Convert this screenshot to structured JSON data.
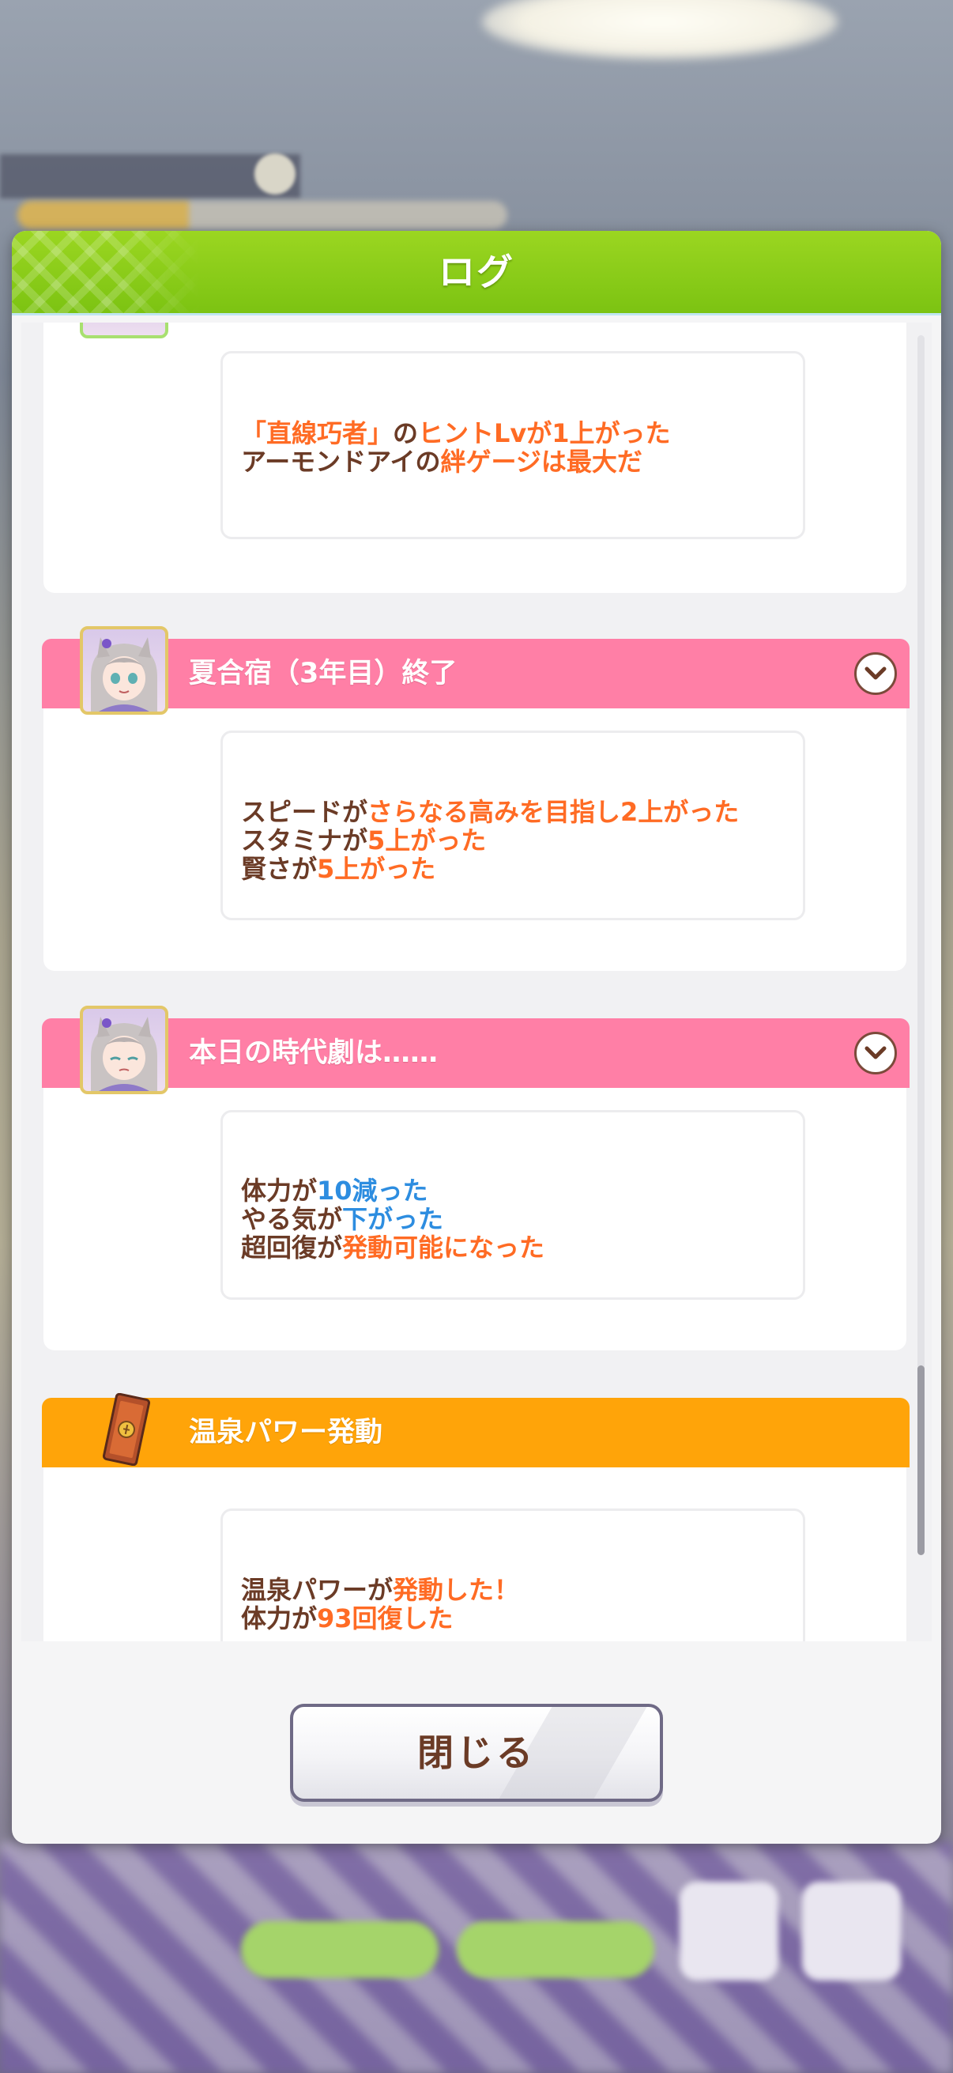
{
  "dialog": {
    "title": "ログ",
    "close_label": "閉じる"
  },
  "entries": [
    {
      "title": "",
      "lines": [
        [
          {
            "t": "「直線巧者」",
            "c": "o"
          },
          {
            "t": "の",
            "c": ""
          },
          {
            "t": "ヒントLvが1上がった",
            "c": "o"
          }
        ],
        [
          {
            "t": "アーモンドアイの",
            "c": ""
          },
          {
            "t": "絆ゲージは最大だ",
            "c": "o"
          }
        ]
      ]
    },
    {
      "title": "夏合宿（3年目）終了",
      "header_color": "pink",
      "lines": [
        [
          {
            "t": "スピードが",
            "c": ""
          },
          {
            "t": "さらなる高みを目指し2上がった",
            "c": "o"
          }
        ],
        [
          {
            "t": "スタミナが",
            "c": ""
          },
          {
            "t": "5上がった",
            "c": "o"
          }
        ],
        [
          {
            "t": "賢さが",
            "c": ""
          },
          {
            "t": "5上がった",
            "c": "o"
          }
        ]
      ]
    },
    {
      "title": "本日の時代劇は……",
      "header_color": "pink",
      "lines": [
        [
          {
            "t": "体力が",
            "c": ""
          },
          {
            "t": "10減った",
            "c": "b"
          }
        ],
        [
          {
            "t": "やる気が",
            "c": ""
          },
          {
            "t": "下がった",
            "c": "b"
          }
        ],
        [
          {
            "t": "超回復が",
            "c": ""
          },
          {
            "t": "発動可能になった",
            "c": "o"
          }
        ]
      ]
    },
    {
      "title": "温泉パワー発動",
      "header_color": "orange",
      "lines": [
        [
          {
            "t": "温泉パワーが",
            "c": ""
          },
          {
            "t": "発動した！",
            "c": "o"
          }
        ],
        [
          {
            "t": "体力が",
            "c": ""
          },
          {
            "t": "93回復した",
            "c": "o"
          }
        ]
      ]
    }
  ],
  "icons": {
    "expand": "chevron-down-icon",
    "character": "character-portrait",
    "ticket": "onsen-ticket-icon"
  },
  "colors": {
    "header_green": "#7cc312",
    "event_pink": "#ff7fa6",
    "event_orange": "#ffa409",
    "text_brown": "#6b3b26",
    "highlight_orange": "#ff6b24",
    "highlight_blue": "#2d8de0"
  }
}
